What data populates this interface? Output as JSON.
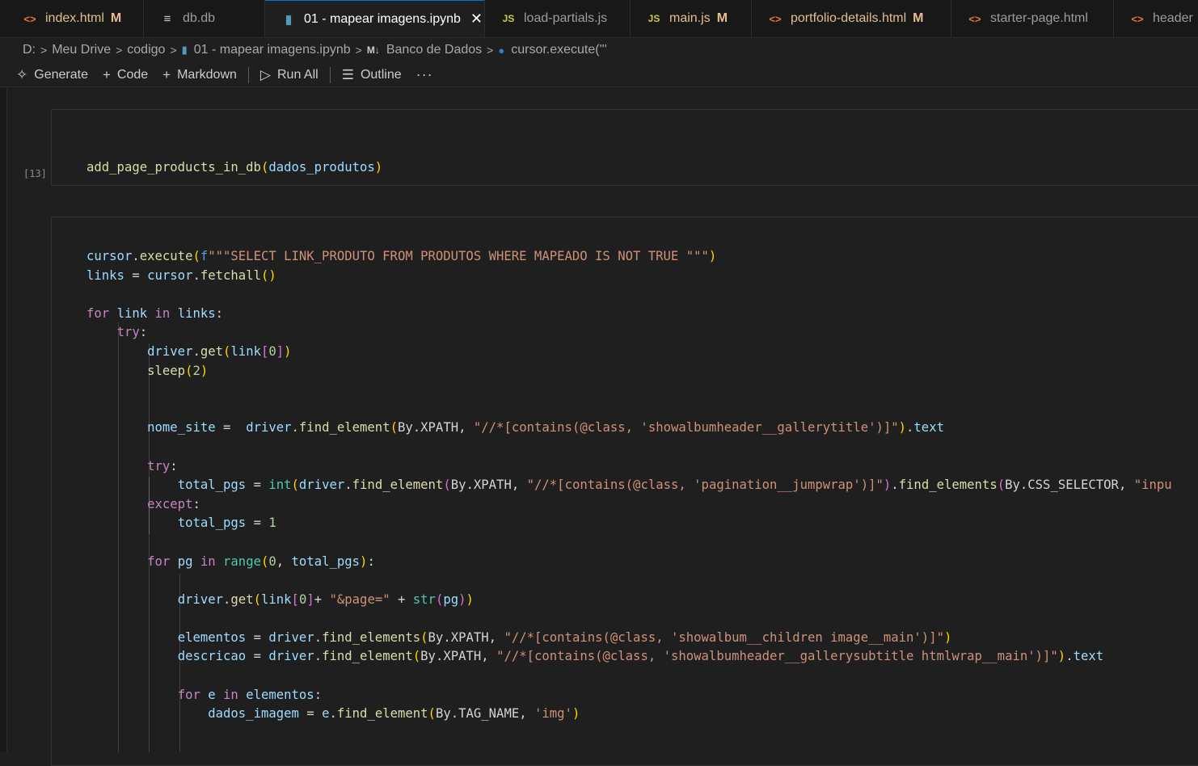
{
  "tabs": [
    {
      "label": "index.html",
      "icon": "html-icon",
      "modified": "M"
    },
    {
      "label": "db.db",
      "icon": "db-icon",
      "modified": ""
    },
    {
      "label": "01 - mapear imagens.ipynb",
      "icon": "notebook-icon",
      "modified": "",
      "active": true
    },
    {
      "label": "load-partials.js",
      "icon": "js-icon",
      "modified": ""
    },
    {
      "label": "main.js",
      "icon": "js-icon",
      "modified": "M"
    },
    {
      "label": "portfolio-details.html",
      "icon": "html-icon",
      "modified": "M"
    },
    {
      "label": "starter-page.html",
      "icon": "html-icon",
      "modified": ""
    },
    {
      "label": "header",
      "icon": "html-icon",
      "modified": ""
    }
  ],
  "breadcrumb": [
    "D:",
    "Meu Drive",
    "codigo",
    "01 - mapear imagens.ipynb",
    "Banco de Dados",
    "cursor.execute('''"
  ],
  "toolbar": {
    "generate": "Generate",
    "code": "Code",
    "markdown": "Markdown",
    "run_all": "Run All",
    "outline": "Outline",
    "more": "···"
  },
  "cell1": {
    "exec_count": "[13]",
    "code": "add_page_products_in_db(dados_produtos)"
  },
  "cell2": {
    "lines": [
      "cursor.execute(f\"\"\"SELECT LINK_PRODUTO FROM PRODUTOS WHERE MAPEADO IS NOT TRUE \"\"\")",
      "links = cursor.fetchall()",
      "",
      "for link in links:",
      "    try:",
      "        driver.get(link[0])",
      "        sleep(2)",
      "",
      "",
      "        nome_site =  driver.find_element(By.XPATH, \"//*[contains(@class, 'showalbumheader__gallerytitle')]\").text",
      "",
      "        try:",
      "            total_pgs = int(driver.find_element(By.XPATH, \"//*[contains(@class, 'pagination__jumpwrap')]\").find_elements(By.CSS_SELECTOR, \"inpu",
      "        except:",
      "            total_pgs = 1",
      "",
      "        for pg in range(0, total_pgs):",
      "",
      "            driver.get(link[0]+ \"&page=\" + str(pg))",
      "",
      "            elementos = driver.find_elements(By.XPATH, \"//*[contains(@class, 'showalbum__children image__main')]\")",
      "            descricao = driver.find_element(By.XPATH, \"//*[contains(@class, 'showalbumheader__gallerysubtitle htmlwrap__main')]\").text",
      "",
      "            for e in elementos:",
      "                dados_imagem = e.find_element(By.TAG_NAME, 'img')"
    ]
  }
}
